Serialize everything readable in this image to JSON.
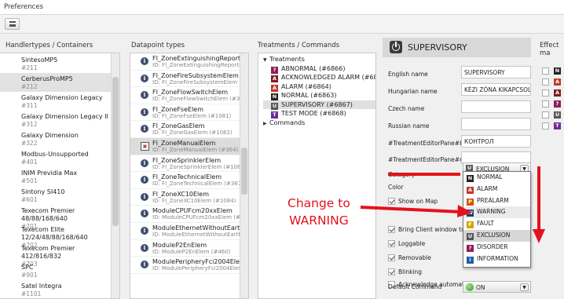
{
  "window": {
    "title": "Preferences"
  },
  "colors": {
    "accent_red": "#e3121b",
    "selection": "#e0e0e0",
    "info_icon": "#3d4f6a"
  },
  "handlertypes": {
    "header": "Handlertypes / Containers",
    "items": [
      {
        "name": "SintesoMP5",
        "id": "#211"
      },
      {
        "name": "CerberusProMP5",
        "id": "#212"
      },
      {
        "name": "Galaxy Dimension Legacy",
        "id": "#311"
      },
      {
        "name": "Galaxy Dimension Legacy II",
        "id": "#312"
      },
      {
        "name": "Galaxy Dimension",
        "id": "#322"
      },
      {
        "name": "Modbus-Unsupported",
        "id": "#401"
      },
      {
        "name": "INIM Previdia Max",
        "id": "#501"
      },
      {
        "name": "Sintony SI410",
        "id": "#601"
      },
      {
        "name": "Texecom Premier 48/88/168/640",
        "id": "#701"
      },
      {
        "name": "Texecom Elite 12/24/48/88/168/640",
        "id": "#702"
      },
      {
        "name": "Texecom Premier 412/816/832",
        "id": "#703"
      },
      {
        "name": "SPC",
        "id": "#901"
      },
      {
        "name": "Satel Integra",
        "id": "#1101"
      }
    ]
  },
  "datapoints": {
    "header": "Datapoint types",
    "items": [
      {
        "name": "FI_ZoneExtinguishingReportElem",
        "id": "ID: FI_ZoneExtinguishingReportElem",
        "icon": "info-icon"
      },
      {
        "name": "FI_ZoneFireSubsystemElem",
        "id": "ID: FI_ZoneFireSubsystemElem (#1080)",
        "icon": "info-icon"
      },
      {
        "name": "FI_ZoneFlowSwitchElem",
        "id": "ID: FI_ZoneFlowSwitchElem (#369)",
        "icon": "info-icon"
      },
      {
        "name": "FI_ZoneFseElem",
        "id": "ID: FI_ZoneFseElem (#1081)",
        "icon": "info-icon"
      },
      {
        "name": "FI_ZoneGasElem",
        "id": "ID: FI_ZoneGasElem (#1082)",
        "icon": "info-icon"
      },
      {
        "name": "FI_ZoneManualElem",
        "id": "ID: FI_ZoneManualElem (#364)",
        "icon": "manual-call-point-icon"
      },
      {
        "name": "FI_ZoneSprinklerElem",
        "id": "ID: FI_ZoneSprinklerElem (#1083)",
        "icon": "info-icon"
      },
      {
        "name": "FI_ZoneTechnicalElem",
        "id": "ID: FI_ZoneTechnicalElem (#367)",
        "icon": "info-icon"
      },
      {
        "name": "FI_ZoneXC10Elem",
        "id": "ID: FI_ZoneXC10Elem (#1084)",
        "icon": "info-icon"
      },
      {
        "name": "ModuleCPUFcm20xxElem",
        "id": "ID: ModuleCPUFcm20xxElem (#458)",
        "icon": "info-icon"
      },
      {
        "name": "ModuleEthernetWithoutEarthFaultElem",
        "id": "ID: ModuleEthernetWithoutEarthFaultEl",
        "icon": "info-icon"
      },
      {
        "name": "ModuleP2EnElem",
        "id": "ID: ModuleP2EnElem (#460)",
        "icon": "info-icon"
      },
      {
        "name": "ModulePeripheryFci2004Elem",
        "id": "ID: ModulePeripheryFci2004Elem (#461)",
        "icon": "info-icon"
      }
    ]
  },
  "treatments": {
    "header": "Treatments / Commands",
    "group_label": "Treatments",
    "items": [
      {
        "label": "ABNORMAL (#6866)",
        "icon": "question-icon",
        "color": "#8e1f57",
        "glyph": "?"
      },
      {
        "label": "ACKNOWLEDGED ALARM (#6865)",
        "icon": "alarm-icon",
        "color": "#7c1f1f",
        "glyph": "A"
      },
      {
        "label": "ALARM (#6864)",
        "icon": "alarm-icon",
        "color": "#c0392b",
        "glyph": "A"
      },
      {
        "label": "NORMAL (#6863)",
        "icon": "normal-icon",
        "color": "#222222",
        "glyph": "N"
      },
      {
        "label": "SUPERVISORY (#6867)",
        "icon": "supervisory-icon",
        "color": "#555555",
        "glyph": "U"
      },
      {
        "label": "TEST MODE (#6868)",
        "icon": "test-icon",
        "color": "#6b2d9a",
        "glyph": "T"
      }
    ],
    "commands_label": "Commands"
  },
  "editor": {
    "title": "SUPERVISORY",
    "fields": [
      {
        "label": "English name",
        "value": "SUPERVISORY"
      },
      {
        "label": "Hungarian name",
        "value": "KÉZI ZÓNA KIKAPCSOLVA"
      },
      {
        "label": "Czech name",
        "value": ""
      },
      {
        "label": "Russian name",
        "value": ""
      },
      {
        "label": "#TreatmentEditorPane#bg",
        "value": "КОНТРОЛ"
      },
      {
        "label": "#TreatmentEditorPane#ro",
        "value": ""
      }
    ],
    "category_label": "Category",
    "category_value": "EXCLUSION",
    "color_label": "Color",
    "checks": [
      {
        "label": "Show on Map",
        "checked": true
      },
      {
        "label": "Bring Client window to fr",
        "checked": true
      },
      {
        "label": "Loggable",
        "checked": true
      },
      {
        "label": "Removable",
        "checked": true
      },
      {
        "label": "Blinking",
        "checked": true
      },
      {
        "label": "Acknowledge automatically",
        "checked": false
      }
    ],
    "default_command_label": "Default Command",
    "default_command_value": "ON"
  },
  "category_options": [
    {
      "label": "NORMAL",
      "icon": "normal-icon",
      "color": "#222222",
      "glyph": "N"
    },
    {
      "label": "ALARM",
      "icon": "alarm-icon",
      "color": "#c0392b",
      "glyph": "A"
    },
    {
      "label": "PREALARM",
      "icon": "prealarm-icon",
      "color": "#d35400",
      "glyph": "P"
    },
    {
      "label": "WARNING",
      "icon": "warning-icon",
      "color": "#1f3a6b",
      "glyph": "W"
    },
    {
      "label": "FAULT",
      "icon": "fault-icon",
      "color": "#d9a400",
      "glyph": "F"
    },
    {
      "label": "EXCLUSION",
      "icon": "exclusion-icon",
      "color": "#555555",
      "glyph": "U"
    },
    {
      "label": "DISORDER",
      "icon": "disorder-icon",
      "color": "#8e1f57",
      "glyph": "?"
    },
    {
      "label": "INFORMATION",
      "icon": "information-icon",
      "color": "#1f5fa8",
      "glyph": "i"
    }
  ],
  "effect": {
    "header": "Effect ma",
    "items": [
      {
        "glyph": "N",
        "color": "#222222",
        "icon": "normal-icon"
      },
      {
        "glyph": "A",
        "color": "#c0392b",
        "icon": "alarm-icon"
      },
      {
        "glyph": "A",
        "color": "#7c1f1f",
        "icon": "alarm-icon"
      },
      {
        "glyph": "?",
        "color": "#8e1f57",
        "icon": "question-icon"
      },
      {
        "glyph": "U",
        "color": "#555555",
        "icon": "supervisory-icon"
      },
      {
        "glyph": "T",
        "color": "#6b2d9a",
        "icon": "test-icon"
      }
    ]
  },
  "annotation": {
    "text_line1": "Change to",
    "text_line2": "WARNING"
  }
}
